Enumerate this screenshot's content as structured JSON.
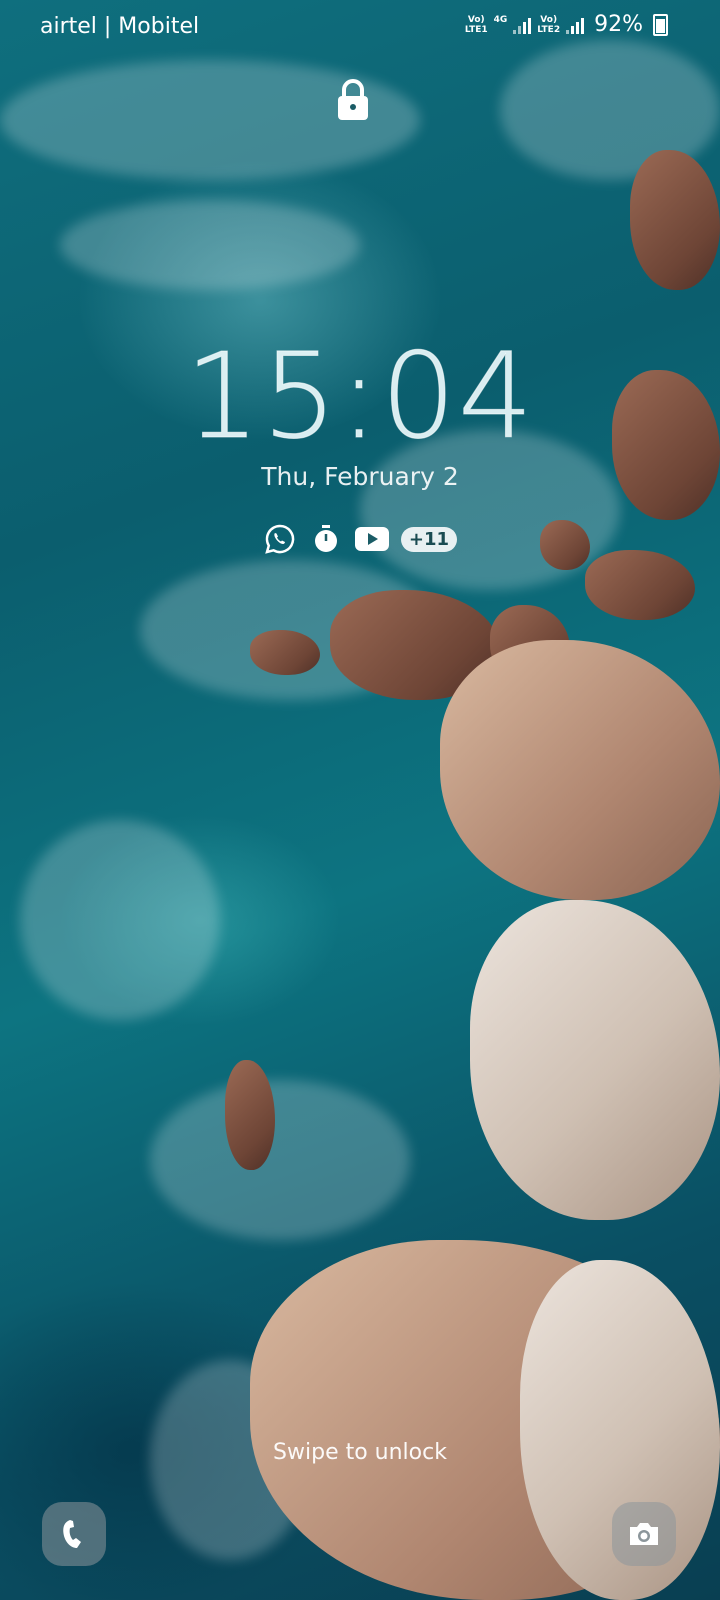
{
  "status_bar": {
    "carrier": "airtel | Mobitel",
    "sim1_tag_top": "Vo)",
    "sim1_tag_bottom": "LTE1",
    "network_type": "4G",
    "sim2_tag_top": "Vo)",
    "sim2_tag_bottom": "LTE2",
    "battery": "92%"
  },
  "lockscreen": {
    "time": "15:04",
    "date": "Thu, February 2",
    "notifications": {
      "icons": [
        "whatsapp-icon",
        "stopwatch-icon",
        "youtube-icon"
      ],
      "more_count": "+11"
    },
    "swipe_hint": "Swipe to unlock"
  },
  "shortcuts": {
    "left": "phone-icon",
    "right": "camera-icon"
  },
  "colors": {
    "sea_dark": "#0a4f63",
    "sea_light": "#0f6f7e",
    "rock": "#b08670"
  }
}
